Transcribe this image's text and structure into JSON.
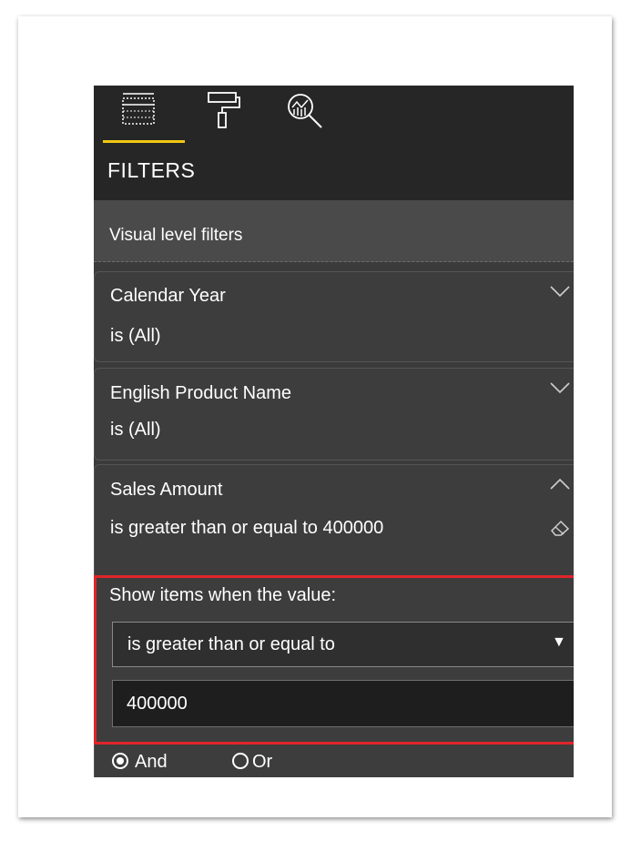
{
  "header": {
    "tabs": [
      {
        "icon": "fields-grid-icon"
      },
      {
        "icon": "paint-roller-icon"
      },
      {
        "icon": "analytics-magnifier-icon"
      }
    ],
    "title": "FILTERS"
  },
  "section": {
    "label": "Visual level filters"
  },
  "filters": [
    {
      "name": "Calendar Year",
      "condition": "is (All)",
      "expanded": false
    },
    {
      "name": "English Product Name",
      "condition": "is (All)",
      "expanded": false
    },
    {
      "name": "Sales Amount",
      "condition": "is greater than or equal to 400000",
      "expanded": true
    }
  ],
  "advanced": {
    "show_label": "Show items when the value:",
    "operator": "is greater than or equal to",
    "operator_arrow": "▼",
    "value": "400000",
    "logic": {
      "and_label": "And",
      "or_label": "Or",
      "selected": "And"
    }
  },
  "colors": {
    "accent": "#f2c811",
    "highlight_border": "#e0242a",
    "panel_bg": "#3b3b3b",
    "topbar_bg": "#262626"
  }
}
